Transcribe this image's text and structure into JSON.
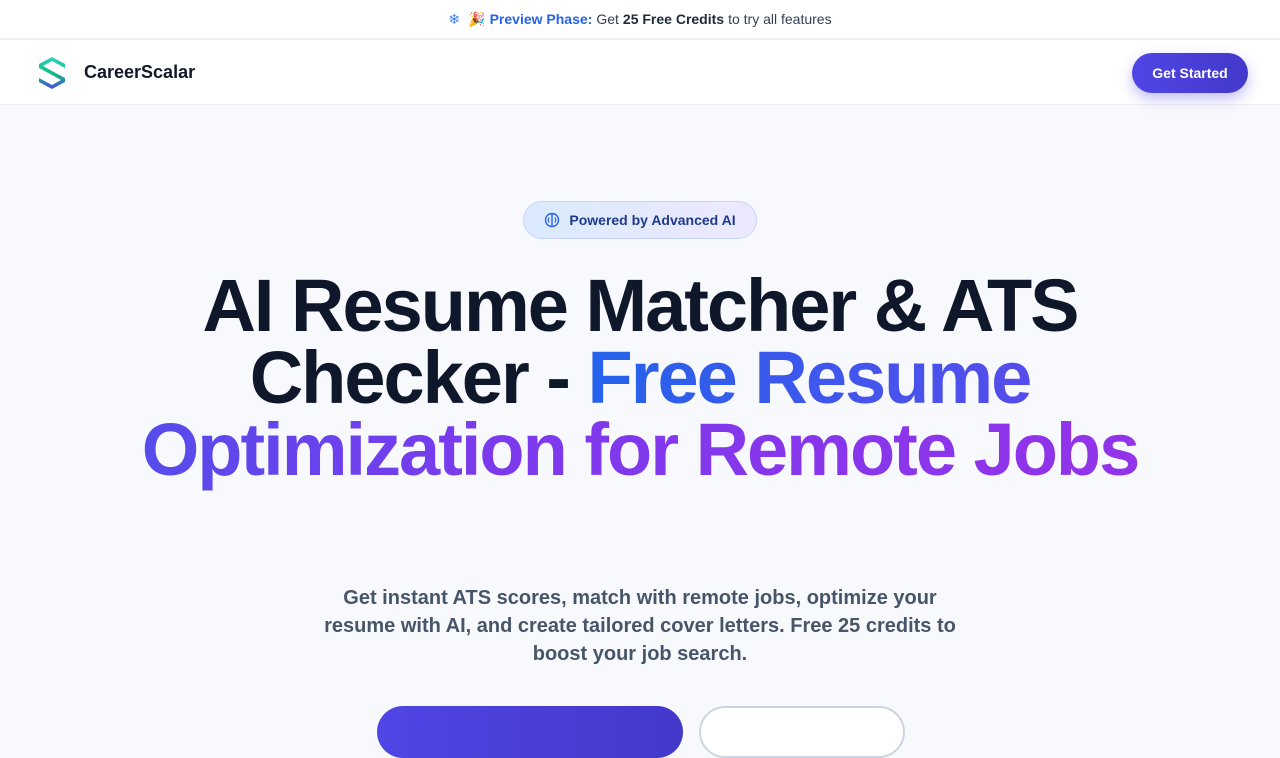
{
  "banner": {
    "sparkle_icon": "sparkle-icon",
    "party_icon": "party-popper-icon",
    "phase_label": "Preview Phase:",
    "text_before": "Get",
    "credits": "25 Free Credits",
    "text_after": "to try all features"
  },
  "nav": {
    "logo_icon": "careerscalar-logo-icon",
    "brand": "CareerScalar",
    "cta_label": "Get Started"
  },
  "hero": {
    "badge_icon": "brain-icon",
    "badge_label": "Powered by Advanced AI",
    "title_plain_line1": "AI Resume Matcher & ATS",
    "title_plain_line2": "Checker -",
    "title_gradient": "Free Resume Optimization for Remote Jobs",
    "subtitle": "Get instant ATS scores, match with remote jobs, optimize your resume with AI, and create tailored cover letters. Free 25 credits to boost your job search.",
    "primary_button_label": "",
    "secondary_button_label": ""
  },
  "colors": {
    "accent": "#4f46e5",
    "gradient_start": "#2563eb",
    "gradient_end": "#9333ea",
    "banner_highlight": "#2563eb"
  }
}
